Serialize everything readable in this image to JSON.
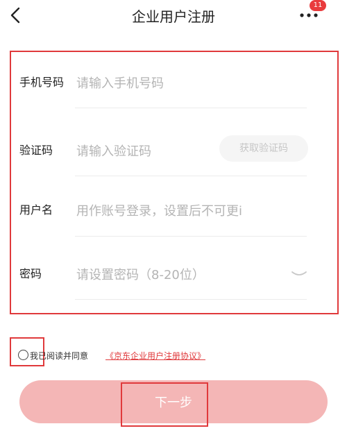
{
  "header": {
    "title": "企业用户注册",
    "badge_count": "11",
    "back_icon": "chevron-left-icon",
    "more_icon": "more-dots-icon"
  },
  "form": {
    "phone": {
      "label": "手机号码",
      "placeholder": "请输入手机号码"
    },
    "code": {
      "label": "验证码",
      "placeholder": "请输入验证码",
      "button": "获取验证码"
    },
    "username": {
      "label": "用户名",
      "placeholder": "用作账号登录，设置后不可更i"
    },
    "password": {
      "label": "密码",
      "placeholder": "请设置密码（8-20位）",
      "toggle_icon": "eye-closed-icon"
    }
  },
  "agreement": {
    "text": "我已阅读并同意",
    "link": "《京东企业用户注册协议》"
  },
  "next_button": {
    "label": "下一步"
  },
  "colors": {
    "highlight_red": "#e0393b",
    "badge_red": "#e93b3d",
    "button_pink": "#f4b6b6",
    "placeholder_gray": "#b4b4b4"
  }
}
